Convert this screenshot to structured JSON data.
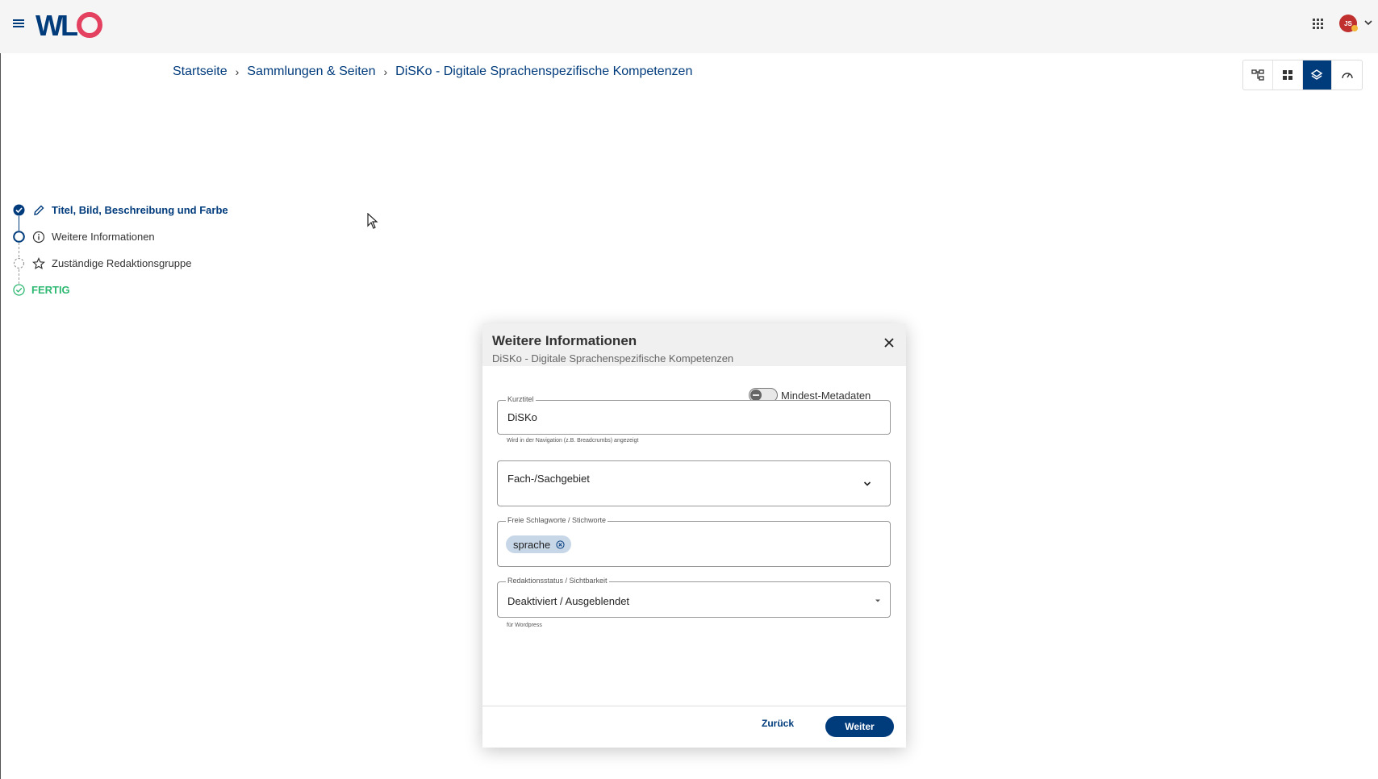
{
  "header": {
    "logo_text": "WLO",
    "avatar_initials": "JS"
  },
  "breadcrumb": [
    {
      "label": "Startseite"
    },
    {
      "label": "Sammlungen & Seiten"
    },
    {
      "label": "DiSKo - Digitale Sprachenspezifische Kompetenzen"
    }
  ],
  "view_switcher": {
    "buttons": [
      "tree-view",
      "grid-view",
      "layers-view",
      "dashboard-view"
    ],
    "active": "layers-view"
  },
  "stepper": {
    "steps": [
      {
        "label": "Titel, Bild, Beschreibung und Farbe",
        "state": "done",
        "icon": "pencil-icon"
      },
      {
        "label": "Weitere Informationen",
        "state": "current",
        "icon": "info-icon"
      },
      {
        "label": "Zuständige Redaktionsgruppe",
        "state": "pending",
        "icon": "star-icon"
      },
      {
        "label": "FERTIG",
        "state": "finish",
        "icon": "check-circle-icon"
      }
    ]
  },
  "dialog": {
    "title": "Weitere Informationen",
    "subtitle": "DiSKo - Digitale Sprachenspezifische Kompetenzen",
    "toggle_label": "Mindest-Metadaten",
    "toggle_on": false,
    "short_title": {
      "label": "Kurztitel",
      "value": "DiSKo",
      "hint": "Wird in der Navigation (z.B. Breadcrumbs) angezeigt"
    },
    "subject": {
      "placeholder": "Fach-/Sachgebiet"
    },
    "keywords": {
      "label": "Freie Schlagworte / Stichworte",
      "chips": [
        "sprache"
      ]
    },
    "status": {
      "label": "Redaktionsstatus / Sichtbarkeit",
      "value": "Deaktiviert / Ausgeblendet",
      "hint": "für Wordpress"
    },
    "back_label": "Zurück",
    "next_label": "Weiter"
  },
  "colors": {
    "primary": "#003b7c",
    "finish": "#2eb872",
    "logo_red": "#e4405f"
  }
}
